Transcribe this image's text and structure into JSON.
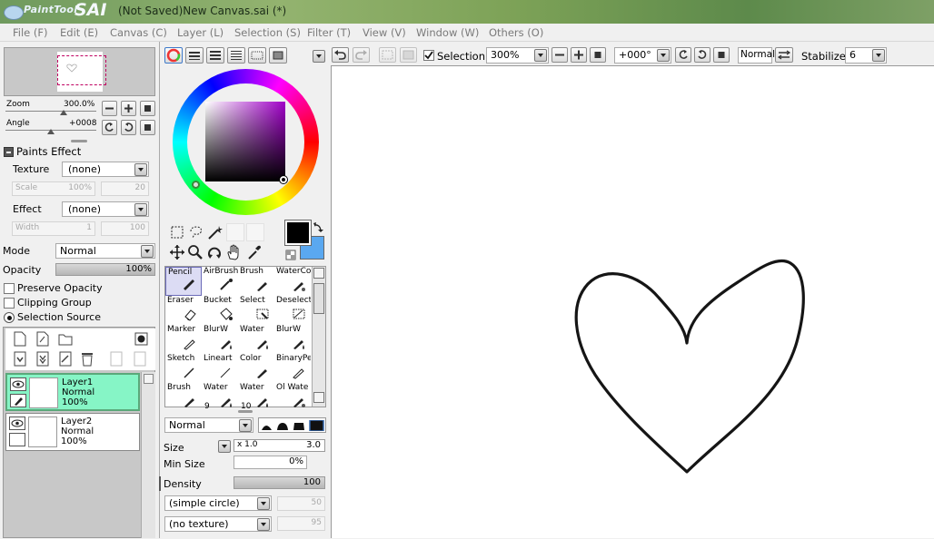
{
  "window": {
    "app_name": "PaintTool",
    "app_name_big": "SAI",
    "title": "(Not Saved)New Canvas.sai (*)"
  },
  "menu": [
    "File (F)",
    "Edit (E)",
    "Canvas (C)",
    "Layer (L)",
    "Selection (S)",
    "Filter (T)",
    "View (V)",
    "Window (W)",
    "Others (O)"
  ],
  "navigator": {
    "zoom_label": "Zoom",
    "zoom_value": "300.0%",
    "angle_label": "Angle",
    "angle_value": "+0008"
  },
  "paints_effect": {
    "header": "Paints Effect",
    "texture_label": "Texture",
    "texture_value": "(none)",
    "scale_label": "Scale",
    "scale_value": "100%",
    "scale_num": "20",
    "effect_label": "Effect",
    "effect_value": "(none)",
    "width_label": "Width",
    "width_value": "1",
    "width_num": "100"
  },
  "layer_props": {
    "mode_label": "Mode",
    "mode_value": "Normal",
    "opacity_label": "Opacity",
    "opacity_value": "100%",
    "preserve_opacity": "Preserve Opacity",
    "clipping_group": "Clipping Group",
    "selection_source": "Selection Source"
  },
  "layers": [
    {
      "name": "Layer1",
      "mode": "Normal",
      "opacity": "100%"
    },
    {
      "name": "Layer2",
      "mode": "Normal",
      "opacity": "100%"
    }
  ],
  "colors": {
    "primary": "#000000",
    "secondary": "#5aa8f0",
    "accent_layer": "#86f5c6"
  },
  "tools": [
    {
      "label": "Pencil",
      "icon": "pencil-icon"
    },
    {
      "label": "AirBrush",
      "icon": "airbrush-icon"
    },
    {
      "label": "Brush",
      "icon": "brush-icon"
    },
    {
      "label": "WaterCo",
      "icon": "watercolor-icon"
    },
    {
      "label": "Eraser",
      "icon": "eraser-icon"
    },
    {
      "label": "Bucket",
      "icon": "bucket-icon"
    },
    {
      "label": "Select",
      "icon": "select-icon"
    },
    {
      "label": "Deselect",
      "icon": "deselect-icon"
    },
    {
      "label": "Marker",
      "icon": "marker-icon"
    },
    {
      "label": "BlurW",
      "icon": "blur-icon"
    },
    {
      "label": "Water",
      "icon": "water-icon"
    },
    {
      "label": "BlurW",
      "icon": "blur-icon"
    },
    {
      "label": "Sketch",
      "icon": "sketch-icon"
    },
    {
      "label": "Lineart",
      "icon": "lineart-icon"
    },
    {
      "label": "Color",
      "icon": "color-icon"
    },
    {
      "label": "BinaryPe",
      "icon": "binary-pen-icon"
    },
    {
      "label": "Brush",
      "icon": "brush-icon",
      "num": ""
    },
    {
      "label": "Water",
      "icon": "water-icon",
      "num": "9"
    },
    {
      "label": "Water",
      "icon": "water-icon",
      "num": "10"
    },
    {
      "label": "Ol Wate",
      "icon": "oil-water-icon",
      "num": ""
    }
  ],
  "brush": {
    "mode_value": "Normal",
    "size_label": "Size",
    "size_mult": "x 1.0",
    "size_value": "3.0",
    "min_size_label": "Min Size",
    "min_size_value": "0%",
    "density_label": "Density",
    "density_value": "100",
    "shape_value": "(simple circle)",
    "shape_num": "50",
    "texture_value": "(no texture)",
    "texture_num": "95"
  },
  "toolbar": {
    "selection_label": "Selection",
    "zoom_value": "300%",
    "angle_value": "+000°",
    "blend_value": "Normal",
    "stabilizer_label": "Stabilizer",
    "stabilizer_value": "6"
  }
}
